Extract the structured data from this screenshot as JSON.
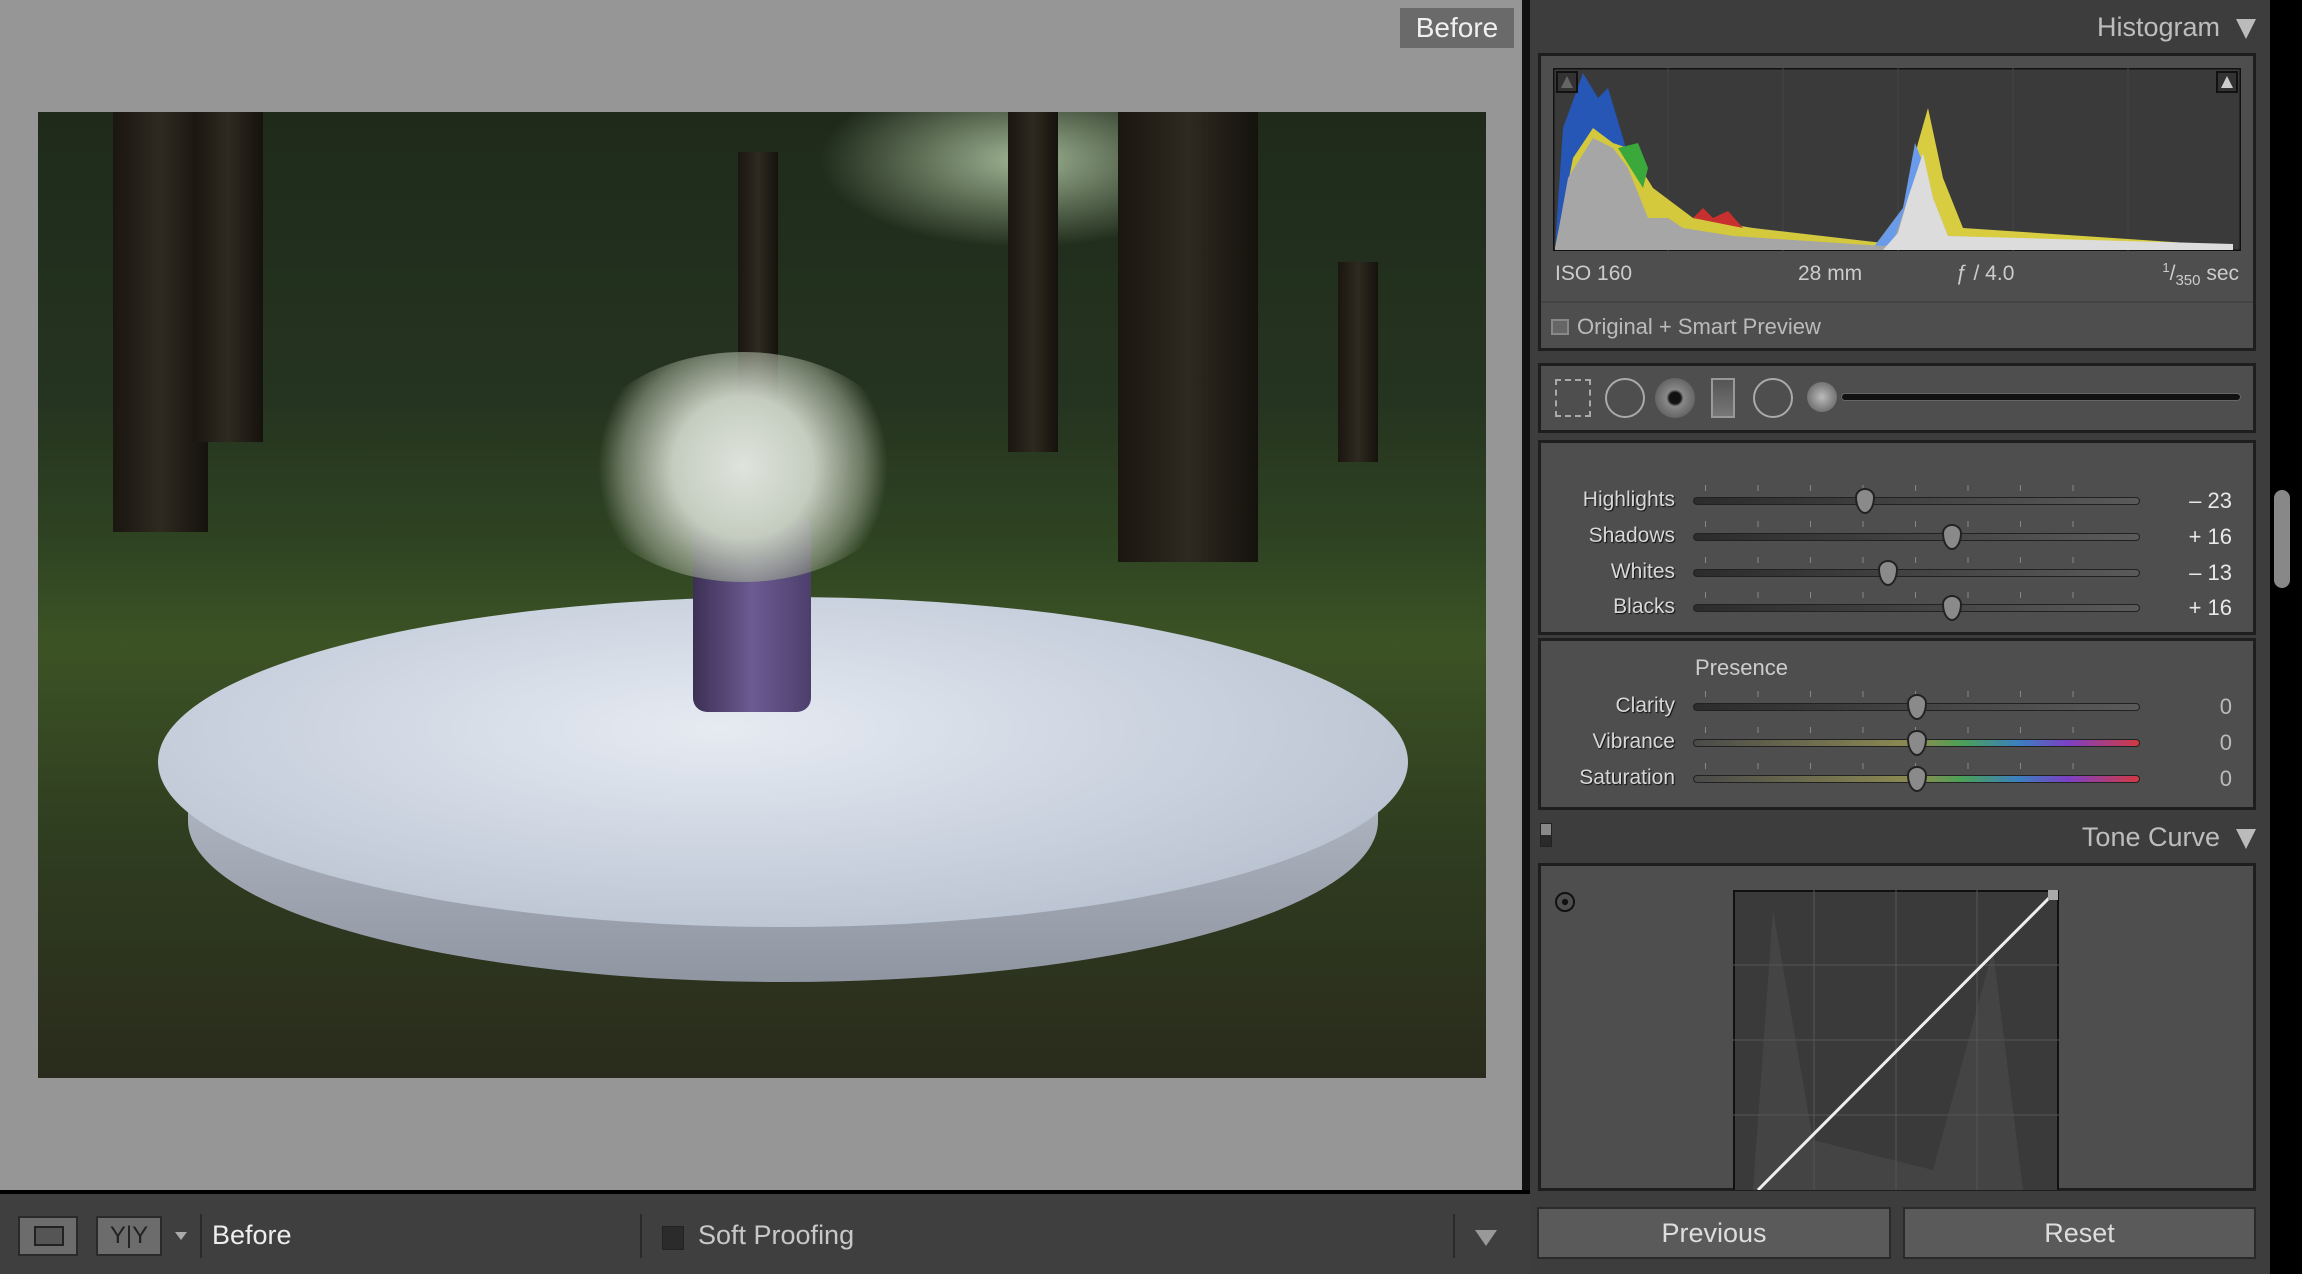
{
  "viewer": {
    "before_label": "Before"
  },
  "histogram": {
    "title": "Histogram",
    "iso": "ISO 160",
    "focal": "28 mm",
    "aperture": "ƒ / 4.0",
    "shutter_num": "1",
    "shutter_den": "350",
    "shutter_unit": "sec",
    "preview_status": "Original + Smart Preview"
  },
  "tools": [
    "crop-overlay",
    "spot-removal",
    "red-eye",
    "graduated-filter",
    "radial-filter",
    "adjustment-brush"
  ],
  "basic": {
    "sliders": [
      {
        "label": "Highlights",
        "value": "– 23",
        "num": -23
      },
      {
        "label": "Shadows",
        "value": "+ 16",
        "num": 16
      },
      {
        "label": "Whites",
        "value": "– 13",
        "num": -13
      },
      {
        "label": "Blacks",
        "value": "+ 16",
        "num": 16
      }
    ],
    "presence_title": "Presence",
    "presence": [
      {
        "label": "Clarity",
        "value": "0",
        "num": 0
      },
      {
        "label": "Vibrance",
        "value": "0",
        "num": 0
      },
      {
        "label": "Saturation",
        "value": "0",
        "num": 0
      }
    ]
  },
  "tone_curve": {
    "title": "Tone Curve"
  },
  "buttons": {
    "previous": "Previous",
    "reset": "Reset"
  },
  "toolbar": {
    "view_mode": "Before",
    "soft_proofing": "Soft Proofing"
  }
}
